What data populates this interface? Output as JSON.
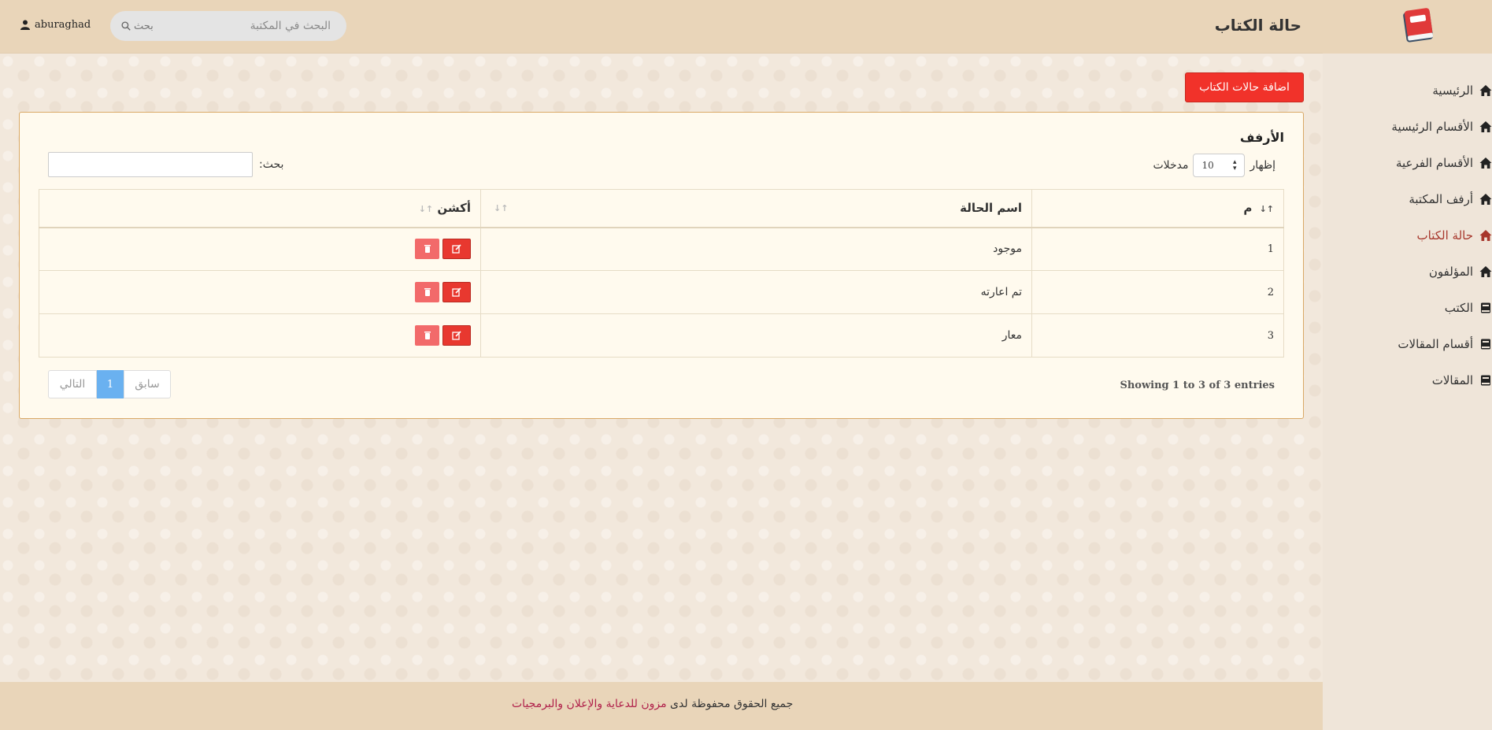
{
  "header": {
    "page_title": "حالة الكتاب",
    "search_placeholder": "البحث في المكتبة",
    "search_button": "بحث",
    "username": "aburaghad"
  },
  "sidebar": {
    "items": [
      {
        "label": "الرئيسية",
        "icon": "home-icon"
      },
      {
        "label": "الأقسام الرئيسية",
        "icon": "home-icon"
      },
      {
        "label": "الأقسام الفرعية",
        "icon": "home-icon"
      },
      {
        "label": "أرفف المكتبة",
        "icon": "home-icon"
      },
      {
        "label": "حالة الكتاب",
        "icon": "home-icon",
        "active": true
      },
      {
        "label": "المؤلفون",
        "icon": "home-icon"
      },
      {
        "label": "الكتب",
        "icon": "book-icon"
      },
      {
        "label": "أقسام المقالات",
        "icon": "book-icon"
      },
      {
        "label": "المقالات",
        "icon": "book-icon"
      }
    ],
    "active_color": "#a7372c"
  },
  "toolbar": {
    "add_label": "اضافة حالات الكتاب",
    "accent": "#f1322a"
  },
  "card": {
    "title": "الأرفف",
    "show_label": "إظهار",
    "entries_label": "مدخلات",
    "page_length": "10",
    "filter_label": "بحث:"
  },
  "table": {
    "headers": [
      "م",
      "اسم الحالة",
      "أكشن"
    ],
    "rows": [
      {
        "num": "1",
        "name": "موجود"
      },
      {
        "num": "2",
        "name": "تم اعارته"
      },
      {
        "num": "3",
        "name": "معار"
      }
    ]
  },
  "pagination": {
    "info": "Showing 1 to 3 of 3 entries",
    "prev": "سابق",
    "current": "1",
    "next": "التالي"
  },
  "footer": {
    "prefix": "جميع الحقوق محفوظة لدى",
    "company": "مزون للدعاية والإعلان والبرمجيات"
  }
}
